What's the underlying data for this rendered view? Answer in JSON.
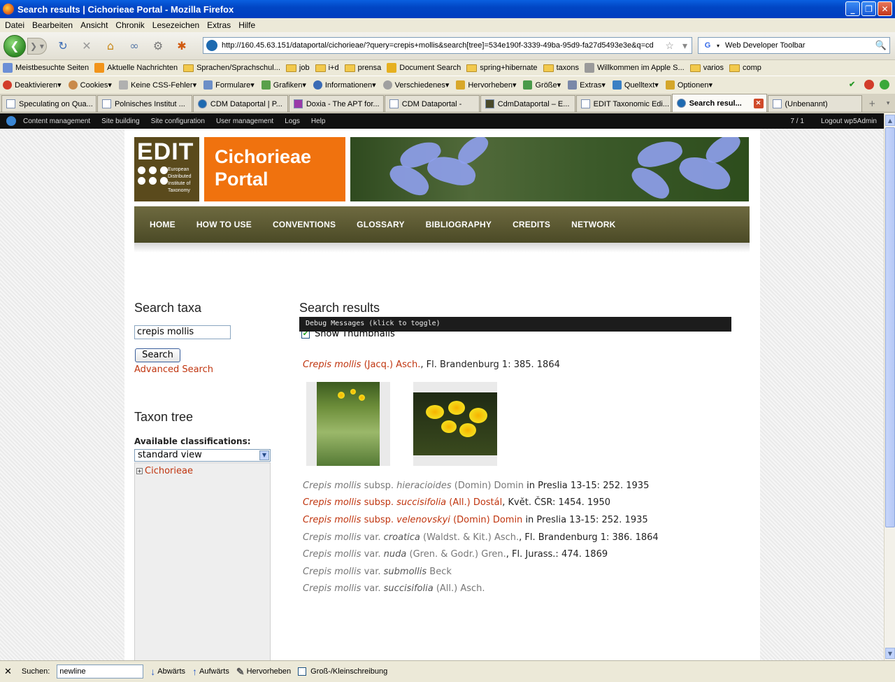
{
  "window": {
    "title": "Search results | Cichorieae Portal - Mozilla Firefox"
  },
  "menu": [
    "Datei",
    "Bearbeiten",
    "Ansicht",
    "Chronik",
    "Lesezeichen",
    "Extras",
    "Hilfe"
  ],
  "address": {
    "url": "http://160.45.63.151/dataportal/cichorieae/?query=crepis+mollis&search[tree]=534e190f-3339-49ba-95d9-fa27d5493e3e&q=cd",
    "search_text": "Web Developer Toolbar"
  },
  "bookmarks": [
    "Meistbesuchte Seiten",
    "Aktuelle Nachrichten",
    "Sprachen/Sprachschul...",
    "job",
    "i+d",
    "prensa",
    "Document Search",
    "spring+hibernate",
    "taxons",
    "Willkommen im Apple S...",
    "varios",
    "comp"
  ],
  "webdev": [
    "Deaktivieren▾",
    "Cookies▾",
    "Keine CSS-Fehler▾",
    "Formulare▾",
    "Grafiken▾",
    "Informationen▾",
    "Verschiedenes▾",
    "Hervorheben▾",
    "Größe▾",
    "Extras▾",
    "Quelltext▾",
    "Optionen▾"
  ],
  "tabs": [
    "Speculating on Qua...",
    "Polnisches Institut ...",
    "CDM Dataportal | P...",
    "Doxia - The APT for...",
    "CDM Dataportal -",
    "CdmDataportal – E...",
    "EDIT Taxonomic Edi...",
    "Search resul...",
    "(Unbenannt)"
  ],
  "admin": {
    "items": [
      "Content management",
      "Site building",
      "Site configuration",
      "User management",
      "Logs",
      "Help"
    ],
    "count": "7 / 1",
    "logout": "Logout wp5Admin"
  },
  "site": {
    "logo_text": "EDIT",
    "logo_sub": [
      "European",
      "Distributed",
      "Institute of",
      "Taxonomy"
    ],
    "title_line1": "Cichorieae",
    "title_line2": "Portal",
    "nav": [
      "HOME",
      "HOW TO USE",
      "CONVENTIONS",
      "GLOSSARY",
      "BIBLIOGRAPHY",
      "CREDITS",
      "NETWORK"
    ]
  },
  "sidebar": {
    "search_heading": "Search taxa",
    "search_value": "crepis mollis",
    "search_button": "Search",
    "advanced": "Advanced Search",
    "tree_heading": "Taxon tree",
    "available": "Available classifications:",
    "selected": "standard view",
    "tree_root": "Cichorieae"
  },
  "results": {
    "heading": "Search results",
    "debug": "Debug Messages (klick to toggle)",
    "thumbs_label": "Show Thumbnails",
    "main": {
      "name": "Crepis mollis",
      "author": "(Jacq.) Asch.",
      "ref": ", Fl. Brandenburg 1: 385. 1864"
    },
    "r1": {
      "genus": "Crepis mollis",
      "rank": "subsp.",
      "epi": "hieracioides",
      "author": "(Domin) Domin",
      "ref": "in Preslia 13-15: 252. 1935"
    },
    "r2": {
      "genus": "Crepis mollis",
      "rank": "subsp.",
      "epi": "succisifolia",
      "author": "(All.) Dostál",
      "ref": ", Květ. ČSR: 1454. 1950"
    },
    "r3": {
      "genus": "Crepis mollis",
      "rank": "subsp.",
      "epi": "velenovskyi",
      "author": "(Domin) Domin",
      "ref": "in Preslia 13-15: 252. 1935"
    },
    "r4": {
      "genus": "Crepis mollis",
      "rank": "var.",
      "epi": "croatica",
      "author": "(Waldst. & Kit.) Asch.",
      "ref": ", Fl. Brandenburg 1: 386. 1864"
    },
    "r5": {
      "genus": "Crepis mollis",
      "rank": "var.",
      "epi": "nuda",
      "author": "(Gren. & Godr.) Gren.",
      "ref": ", Fl. Jurass.: 474. 1869"
    },
    "r6": {
      "genus": "Crepis mollis",
      "rank": "var.",
      "epi": "submollis",
      "author": "Beck"
    },
    "r7": {
      "genus": "Crepis mollis",
      "rank": "var.",
      "epi": "succisifolia",
      "author": "(All.) Asch."
    }
  },
  "findbar": {
    "label": "Suchen:",
    "value": "newline",
    "down": "Abwärts",
    "up": "Aufwärts",
    "highlight": "Hervorheben",
    "case": "Groß-/Kleinschreibung"
  }
}
